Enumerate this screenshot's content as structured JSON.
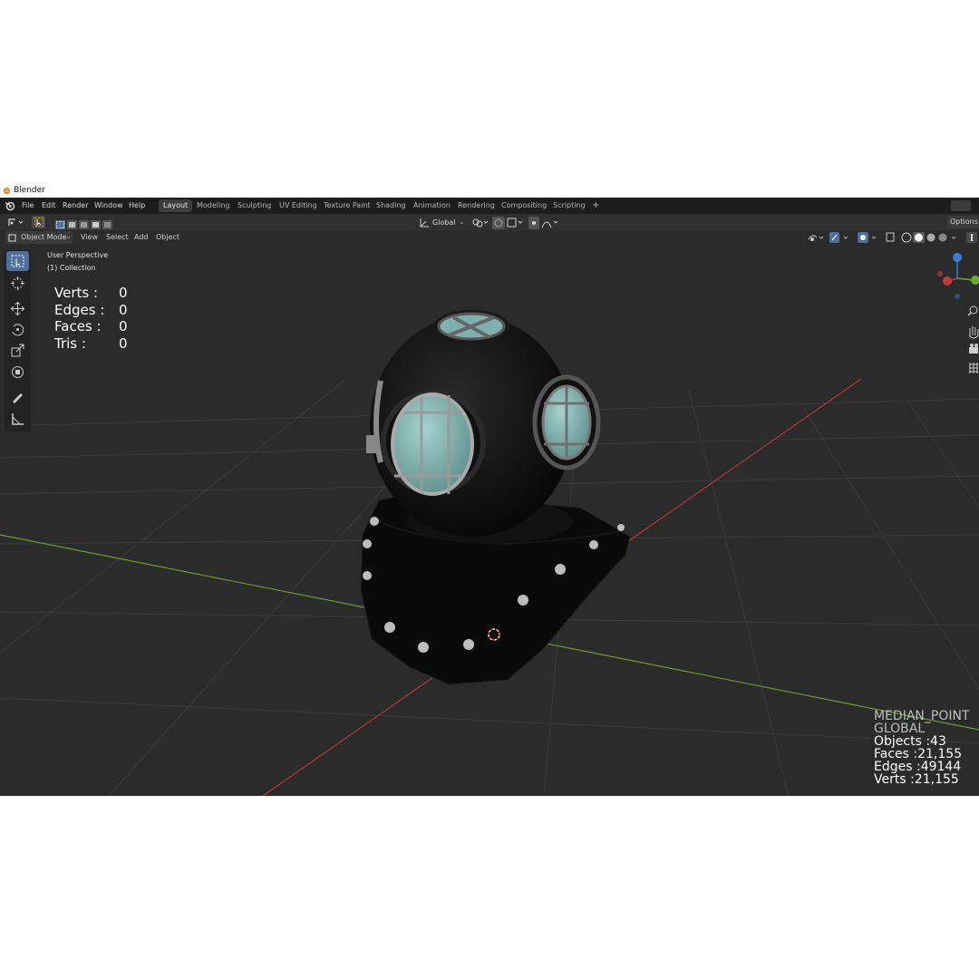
{
  "window": {
    "title": "Blender"
  },
  "menu": {
    "items": [
      "File",
      "Edit",
      "Render",
      "Window",
      "Help"
    ]
  },
  "workspaces": {
    "tabs": [
      "Layout",
      "Modeling",
      "Sculpting",
      "UV Editing",
      "Texture Paint",
      "Shading",
      "Animation",
      "Rendering",
      "Compositing",
      "Scripting"
    ],
    "active": "Layout",
    "add_label": "+"
  },
  "tool_header": {
    "orientation": "Global",
    "options_label": "Options"
  },
  "viewport_header": {
    "mode": "Object Mode",
    "menus": [
      "View",
      "Select",
      "Add",
      "Object"
    ]
  },
  "viewport": {
    "perspective": "User Perspective",
    "collection": "(1) Collection"
  },
  "stats_selected": {
    "rows": [
      {
        "label": "Verts :",
        "value": "0"
      },
      {
        "label": "Edges :",
        "value": "0"
      },
      {
        "label": "Faces :",
        "value": "0"
      },
      {
        "label": "Tris :",
        "value": "0"
      }
    ]
  },
  "stats_scene": {
    "pivot": "MEDIAN_POINT",
    "orientation": "GLOBAL",
    "objects": "Objects :43",
    "faces": "Faces :21,155",
    "edges": "Edges :49144",
    "verts": "Verts :21,155"
  },
  "colors": {
    "viewport_bg": "#2b2b2b",
    "grid": "#3a3a3a",
    "x_axis": "#b33838",
    "y_axis": "#6f9a2d",
    "active_tool": "#4f6f9f",
    "glass": "#7fb0ae"
  },
  "icons": [
    "blender-logo-icon",
    "select-box-icon",
    "cursor-icon",
    "move-icon",
    "rotate-icon",
    "scale-icon",
    "transform-icon",
    "annotate-icon",
    "measure-icon",
    "zoom-icon",
    "hand-icon",
    "camera-icon",
    "grid-icon",
    "navigation-gizmo-icon"
  ]
}
